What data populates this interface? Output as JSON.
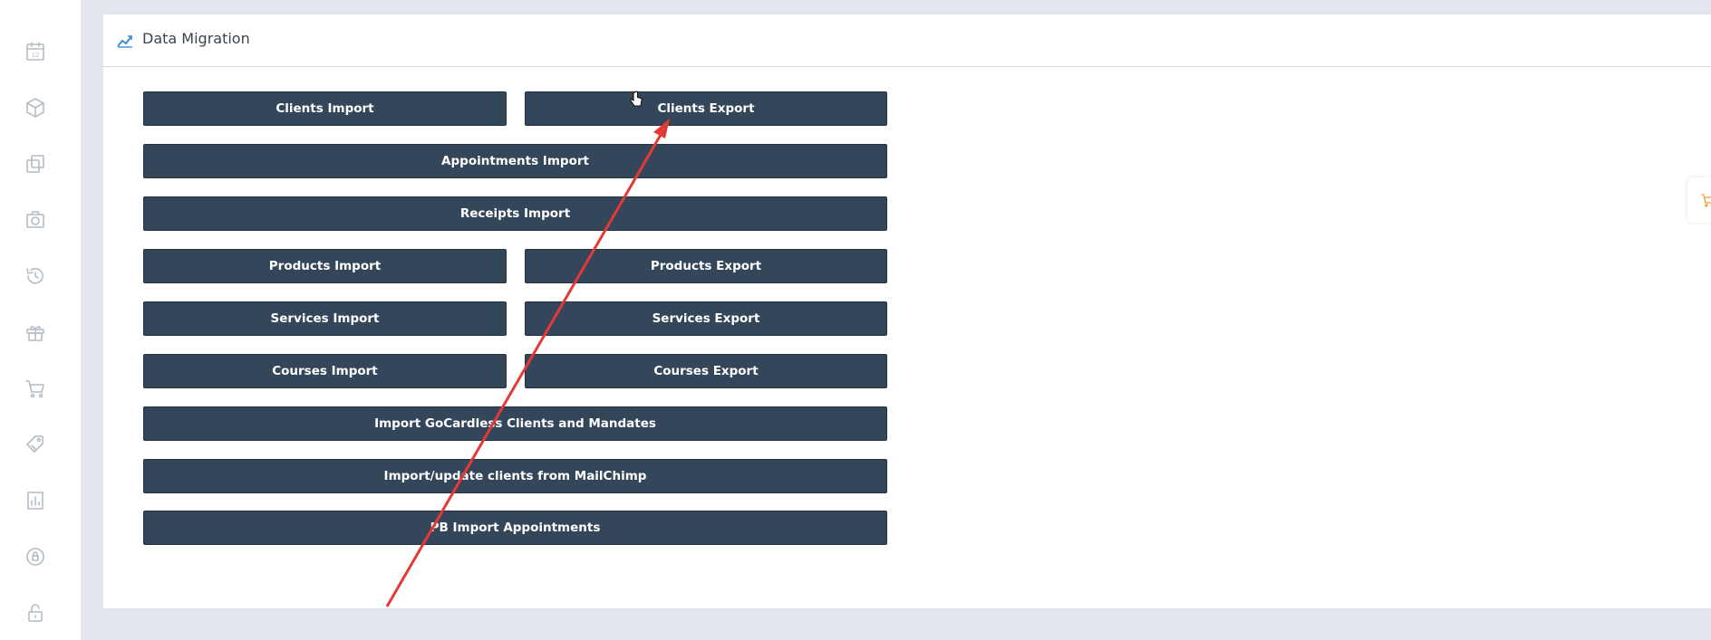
{
  "panel": {
    "title": "Data Migration",
    "header_icon": "line-chart-icon",
    "accent_color": "#3a8fd9"
  },
  "sidebar": {
    "icons": [
      "calendar-icon",
      "cube-icon",
      "copy-icon",
      "camera-icon",
      "history-icon",
      "gift-icon",
      "cart-icon",
      "tags-icon",
      "bar-chart-icon",
      "lock-circle-icon",
      "unlock-icon"
    ],
    "calendar_day": "12"
  },
  "buttons": {
    "clients_import": "Clients Import",
    "clients_export": "Clients Export",
    "appointments_import": "Appointments Import",
    "receipts_import": "Receipts Import",
    "products_import": "Products Import",
    "products_export": "Products Export",
    "services_import": "Services Import",
    "services_export": "Services Export",
    "courses_import": "Courses Import",
    "courses_export": "Courses Export",
    "gocardless_import": "Import GoCardless Clients and Mandates",
    "mailchimp_import": "Import/update clients from MailChimp",
    "pb_import": "PB Import Appointments"
  },
  "colors": {
    "button_bg": "#344659",
    "annotation_arrow": "#e53935",
    "cart_tab_icon": "#f0a030"
  }
}
